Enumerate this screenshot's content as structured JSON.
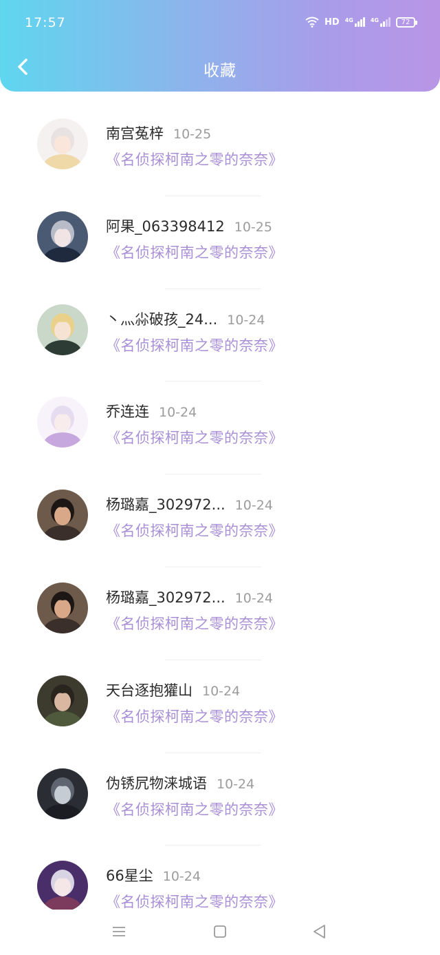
{
  "status": {
    "time": "17:57",
    "hd": "HD",
    "net1": "4G",
    "net2": "4G",
    "battery": "72"
  },
  "header": {
    "back_icon": "chevron-left-icon",
    "title": "收藏"
  },
  "items": [
    {
      "name": "南宫菟梓",
      "date": "10-25",
      "book": "《名侦探柯南之零的奈奈》",
      "avatar": "anime-girl-white-hair"
    },
    {
      "name": "阿果_063398412",
      "date": "10-25",
      "book": "《名侦探柯南之零的奈奈》",
      "avatar": "anime-girl-dark"
    },
    {
      "name": "丶灬尛破孩_24...",
      "date": "10-24",
      "book": "《名侦探柯南之零的奈奈》",
      "avatar": "anime-boy-blonde"
    },
    {
      "name": "乔连连",
      "date": "10-24",
      "book": "《名侦探柯南之零的奈奈》",
      "avatar": "anime-girl-flowers"
    },
    {
      "name": "杨璐嘉_302972...",
      "date": "10-24",
      "book": "《名侦探柯南之零的奈奈》",
      "avatar": "photo-person"
    },
    {
      "name": "杨璐嘉_302972...",
      "date": "10-24",
      "book": "《名侦探柯南之零的奈奈》",
      "avatar": "photo-person"
    },
    {
      "name": "天台逐抱獾山",
      "date": "10-24",
      "book": "《名侦探柯南之零的奈奈》",
      "avatar": "anime-soldier"
    },
    {
      "name": "伪锈凥物涞城语",
      "date": "10-24",
      "book": "《名侦探柯南之零的奈奈》",
      "avatar": "smoke-person"
    },
    {
      "name": "66星尘",
      "date": "10-24",
      "book": "《名侦探柯南之零的奈奈》",
      "avatar": "anime-boy-silver"
    }
  ],
  "bottom_nav": {
    "menu_icon": "menu-icon",
    "home_icon": "home-square-icon",
    "back_icon": "back-triangle-icon"
  },
  "colors": {
    "header_start": "#5fd6ef",
    "header_end": "#b995e6",
    "book_title": "#a98fd6",
    "date": "#9c9c9c"
  }
}
